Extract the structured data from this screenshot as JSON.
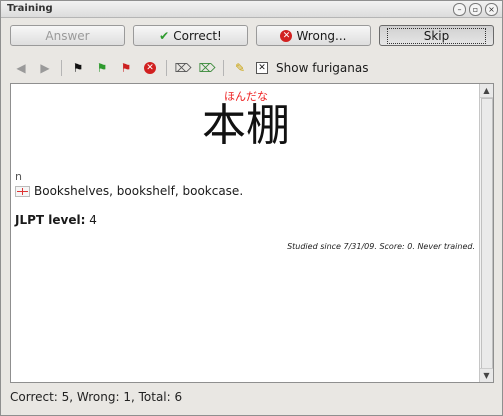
{
  "window": {
    "title": "Training"
  },
  "buttons": {
    "answer": "Answer",
    "correct": "Correct!",
    "wrong": "Wrong...",
    "skip": "Skip"
  },
  "toolbar": {
    "icons": [
      "back-arrow-icon",
      "forward-arrow-icon",
      "black-flag-icon",
      "green-flag-icon",
      "red-flag-icon",
      "remove-icon",
      "tag-icon",
      "tag-edit-icon",
      "pencil-icon"
    ],
    "show_furiganas_label": "Show furiganas",
    "show_furiganas_checked": true
  },
  "card": {
    "furigana": "ほんだな",
    "kanji": "本棚",
    "part_of_speech": "n",
    "meaning": "Bookshelves, bookshelf, bookcase.",
    "jlpt_label": "JLPT level:",
    "jlpt_value": "4",
    "studied_info": "Studied since 7/31/09. Score: 0. Never trained."
  },
  "status": {
    "text": "Correct: 5, Wrong: 1, Total: 6"
  },
  "colors": {
    "furigana": "#ee2222",
    "correct_icon": "#2e9a2e",
    "wrong_icon": "#d12020"
  }
}
